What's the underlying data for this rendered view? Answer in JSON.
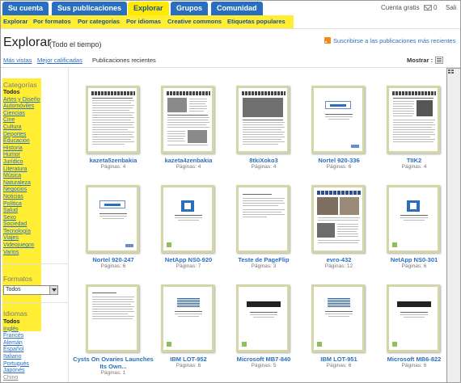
{
  "topnav": {
    "tabs": [
      {
        "label": "Su cuenta",
        "active": false
      },
      {
        "label": "Sus publicaciones",
        "active": false
      },
      {
        "label": "Explorar",
        "active": true
      },
      {
        "label": "Grupos",
        "active": false
      },
      {
        "label": "Comunidad",
        "active": false
      }
    ],
    "account_type": "Cuenta gratis",
    "mail_count": "0",
    "exit_label": "Sali"
  },
  "subnav": {
    "items": [
      "Explorar",
      "Por formatos",
      "Por categorías",
      "Por idiomas",
      "Creative commons",
      "Etiquetas populares"
    ]
  },
  "header": {
    "title": "Explorar",
    "subtitle": "(Todo el tiempo)",
    "rss_label": "Suscribirse a las publicaciones más recientes"
  },
  "sort": {
    "options": [
      "Más vistas",
      "Mejor calificadas",
      "Publicaciones recientes"
    ],
    "current_index": 2
  },
  "view": {
    "label": "Mostrar :",
    "modes": [
      "list-view-icon",
      "grid-view-icon"
    ],
    "current": "grid"
  },
  "sidebar": {
    "categories_heading": "Categorías",
    "categories": [
      "Todos",
      "Artes y Diseño",
      "Automóviles",
      "Ciencias",
      "Cine",
      "Cultura",
      "Deportes",
      "Educación",
      "Historia",
      "Humor",
      "Jurídico",
      "Literatura",
      "Música",
      "Naturaleza",
      "Negocios",
      "Noticias",
      "Política",
      "Salud",
      "Sexo",
      "Sociedad",
      "Tecnología",
      "Viajes",
      "Videojuegos",
      "Varios"
    ],
    "formats_heading": "Formatos",
    "format_selected": "Todos",
    "languages_heading": "Idiomas",
    "languages": [
      "Todos",
      "Inglés",
      "Francés",
      "Alemán",
      "Español",
      "Italiano",
      "Portugués",
      "Japonés",
      "Chino"
    ]
  },
  "publications": [
    {
      "title": "kazeta5zenbakia",
      "pages": "Páginas: 4"
    },
    {
      "title": "kazeta4zenbakia",
      "pages": "Páginas: 4"
    },
    {
      "title": "8tkiXoko3",
      "pages": "Páginas: 4"
    },
    {
      "title": "Nortel 920-336",
      "pages": "Páginas: 6"
    },
    {
      "title": "TIIK2",
      "pages": "Páginas: 4"
    },
    {
      "title": "Nortel 920-247",
      "pages": "Páginas: 6"
    },
    {
      "title": "NetApp NS0-920",
      "pages": "Páginas: 7"
    },
    {
      "title": "Teste de PageFlip",
      "pages": "Páginas: 3"
    },
    {
      "title": "evro-432",
      "pages": "Páginas: 12"
    },
    {
      "title": "NetApp NS0-301",
      "pages": "Páginas: 6"
    },
    {
      "title": "Cysts On Ovaries Launches Its Own...",
      "pages": "Páginas: 1"
    },
    {
      "title": "IBM LOT-952",
      "pages": "Páginas: 6"
    },
    {
      "title": "Microsoft MB7-840",
      "pages": "Páginas: 5"
    },
    {
      "title": "IBM LOT-951",
      "pages": "Páginas: 6"
    },
    {
      "title": "Microsoft MB6-822",
      "pages": "Páginas: 6"
    }
  ]
}
